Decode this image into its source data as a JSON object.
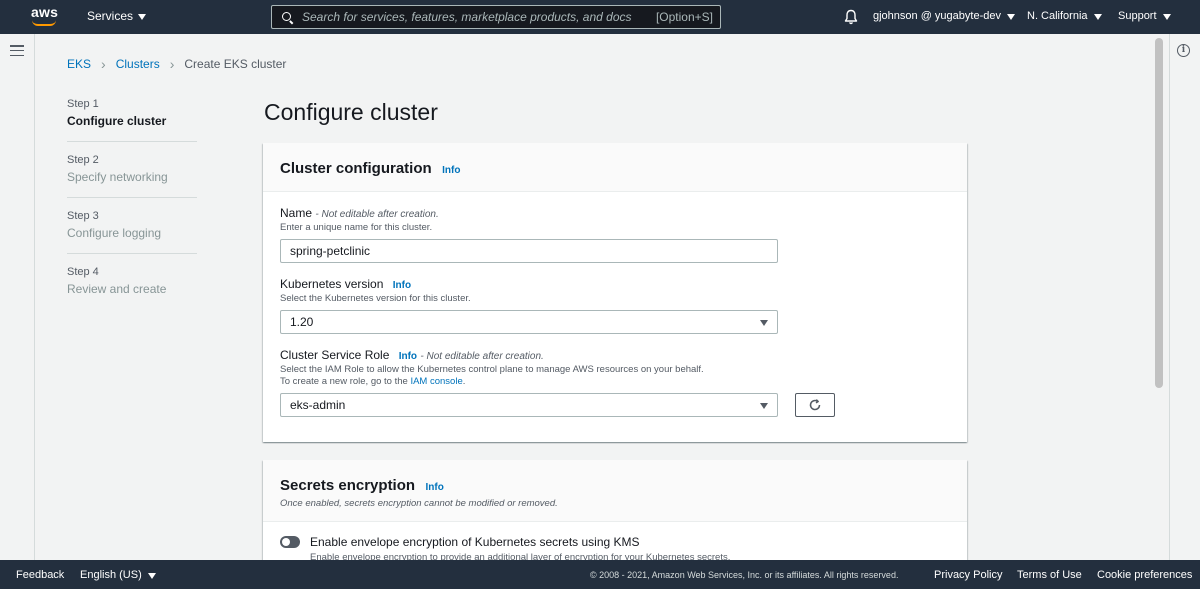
{
  "topnav": {
    "logo": "aws",
    "services_label": "Services",
    "search_placeholder": "Search for services, features, marketplace products, and docs",
    "search_shortcut": "[Option+S]",
    "account": "gjohnson @ yugabyte-dev",
    "region": "N. California",
    "support": "Support"
  },
  "breadcrumb": {
    "items": [
      "EKS",
      "Clusters"
    ],
    "current": "Create EKS cluster"
  },
  "steps": [
    {
      "num": "Step 1",
      "title": "Configure cluster"
    },
    {
      "num": "Step 2",
      "title": "Specify networking"
    },
    {
      "num": "Step 3",
      "title": "Configure logging"
    },
    {
      "num": "Step 4",
      "title": "Review and create"
    }
  ],
  "page_title": "Configure cluster",
  "cluster_config": {
    "title": "Cluster configuration",
    "info": "Info",
    "name": {
      "label": "Name",
      "note": "- Not editable after creation.",
      "desc": "Enter a unique name for this cluster.",
      "value": "spring-petclinic"
    },
    "k8s_version": {
      "label": "Kubernetes version",
      "info": "Info",
      "desc": "Select the Kubernetes version for this cluster.",
      "value": "1.20"
    },
    "service_role": {
      "label": "Cluster Service Role",
      "info": "Info",
      "note": "- Not editable after creation.",
      "desc": "Select the IAM Role to allow the Kubernetes control plane to manage AWS resources on your behalf.",
      "desc2": "To create a new role, go to the",
      "desc2_link": "IAM console",
      "desc2_end": ".",
      "value": "eks-admin"
    }
  },
  "secrets": {
    "title": "Secrets encryption",
    "info": "Info",
    "subtitle": "Once enabled, secrets encryption cannot be modified or removed.",
    "toggle_label": "Enable envelope encryption of Kubernetes secrets using KMS",
    "toggle_desc": "Enable envelope encryption to provide an additional layer of encryption for your Kubernetes secrets."
  },
  "footer": {
    "feedback": "Feedback",
    "language": "English (US)",
    "copyright": "© 2008 - 2021, Amazon Web Services, Inc. or its affiliates. All rights reserved.",
    "privacy": "Privacy Policy",
    "terms": "Terms of Use",
    "cookies": "Cookie preferences"
  },
  "icons": {
    "search": "search-icon",
    "bell": "bell-icon",
    "menu": "hamburger-icon",
    "info": "info-icon",
    "refresh": "refresh-icon"
  }
}
